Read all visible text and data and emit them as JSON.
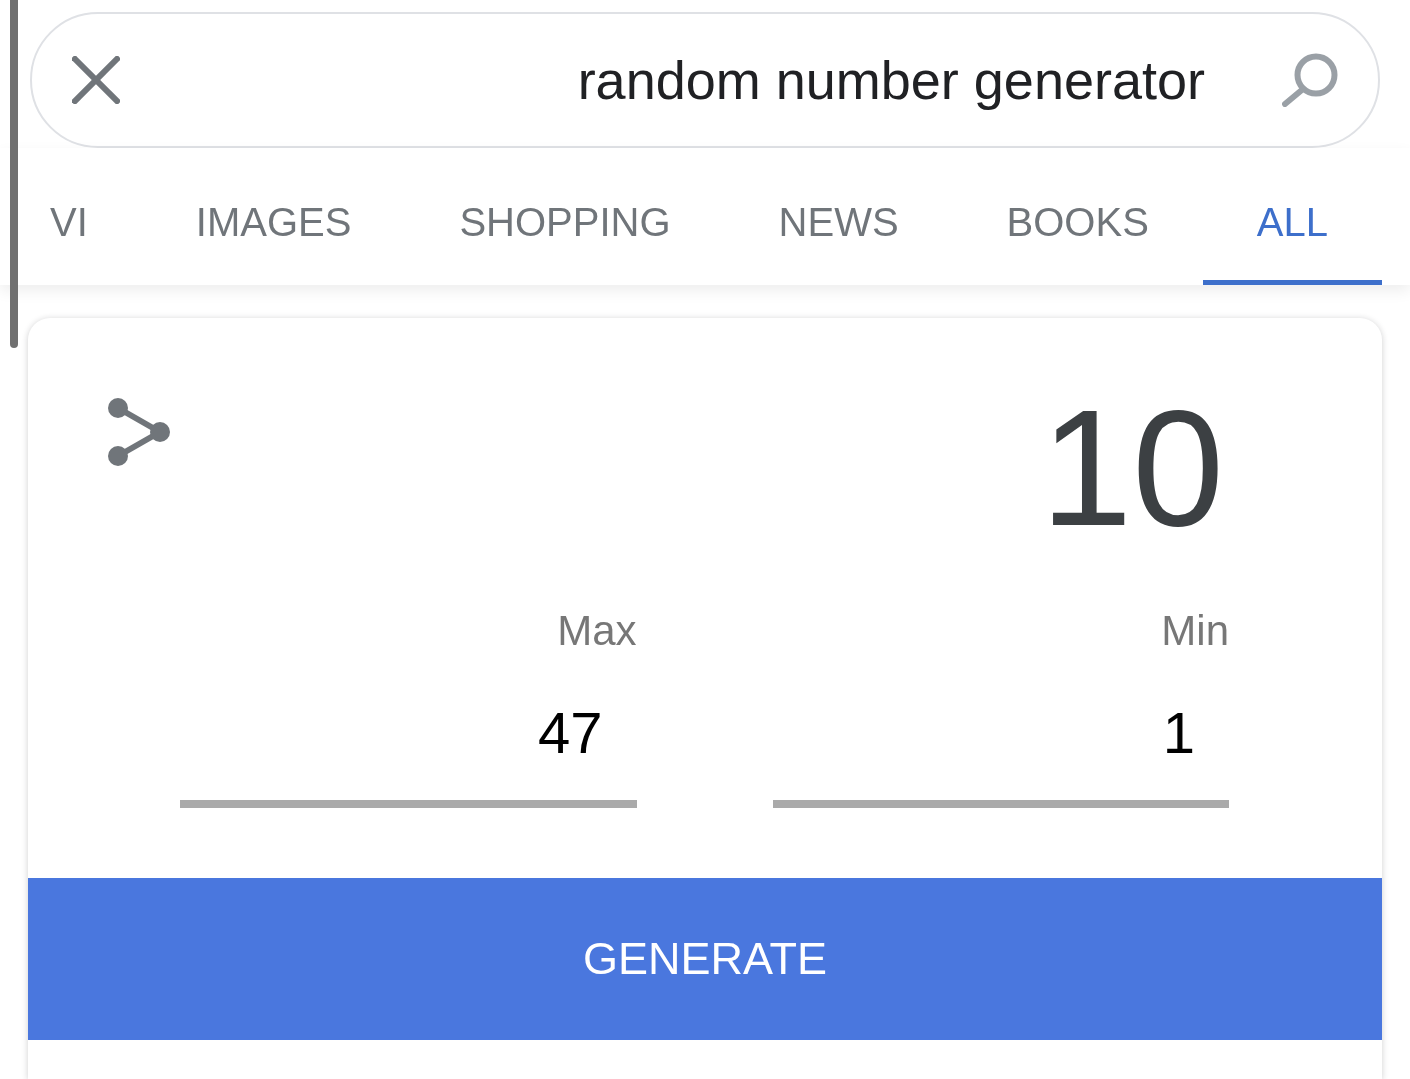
{
  "search": {
    "query": "random number generator"
  },
  "tabs": [
    {
      "label": "VI",
      "selected": false
    },
    {
      "label": "IMAGES",
      "selected": false
    },
    {
      "label": "SHOPPING",
      "selected": false
    },
    {
      "label": "NEWS",
      "selected": false
    },
    {
      "label": "BOOKS",
      "selected": false
    },
    {
      "label": "ALL",
      "selected": true
    }
  ],
  "generator": {
    "result": "10",
    "fields": [
      {
        "label": "Max",
        "value": "47"
      },
      {
        "label": "Min",
        "value": "1"
      }
    ],
    "button": "GENERATE"
  }
}
